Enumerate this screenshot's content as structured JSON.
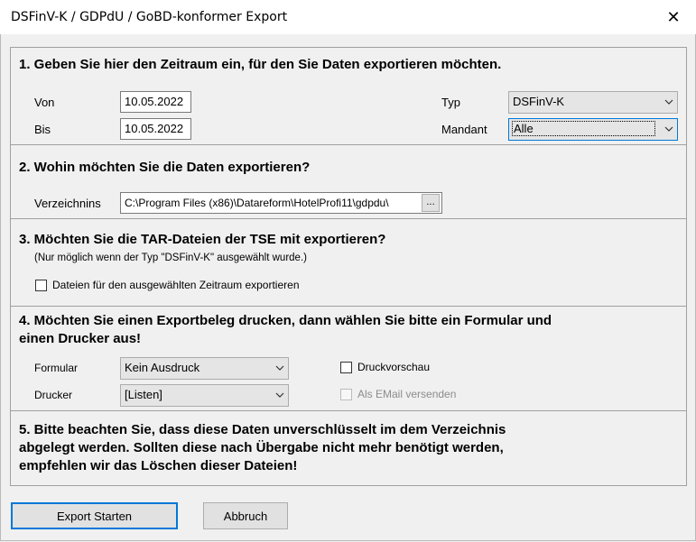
{
  "window": {
    "title": "DSFinV-K / GDPdU / GoBD-konformer Export",
    "close_glyph": "✕"
  },
  "section1": {
    "heading": "1. Geben Sie hier den Zeitraum ein, für den Sie Daten exportieren möchten.",
    "von_label": "Von",
    "von_value": "10.05.2022",
    "bis_label": "Bis",
    "bis_value": "10.05.2022",
    "typ_label": "Typ",
    "typ_value": "DSFinV-K",
    "mandant_label": "Mandant",
    "mandant_value": "Alle"
  },
  "section2": {
    "heading": "2. Wohin möchten Sie die Daten exportieren?",
    "dir_label": "Verzeichnins",
    "dir_value": "C:\\Program Files (x86)\\Datareform\\HotelProfi11\\gdpdu\\",
    "browse_label": "..."
  },
  "section3": {
    "heading": "3. Möchten Sie die TAR-Dateien der TSE mit exportieren?",
    "note": "(Nur möglich wenn der Typ \"DSFinV-K\" ausgewählt wurde.)",
    "checkbox_label": "Dateien für den ausgewählten Zeitraum exportieren"
  },
  "section4": {
    "heading_line1": "4. Möchten Sie einen Exportbeleg drucken, dann wählen Sie bitte ein Formular und",
    "heading_line2": "einen Drucker aus!",
    "formular_label": "Formular",
    "formular_value": "Kein Ausdruck",
    "drucker_label": "Drucker",
    "drucker_value": "[Listen]",
    "preview_label": "Druckvorschau",
    "email_label": "Als EMail versenden"
  },
  "section5": {
    "line1": "5. Bitte beachten Sie, dass diese Daten unverschlüsselt im dem Verzeichnis",
    "line2": "abgelegt werden. Sollten diese nach Übergabe nicht mehr benötigt werden,",
    "line3": "empfehlen wir das Löschen dieser Dateien!"
  },
  "buttons": {
    "export": "Export Starten",
    "cancel": "Abbruch"
  }
}
